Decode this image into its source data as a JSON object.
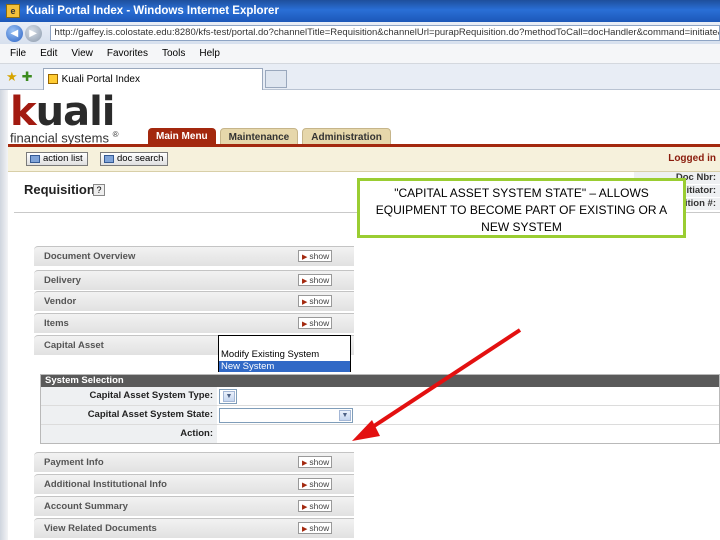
{
  "window": {
    "title": "Kuali Portal Index - Windows Internet Explorer"
  },
  "address": {
    "url": "http://gaffey.is.colostate.edu:8280/kfs-test/portal.do?channelTitle=Requisition&channelUrl=purapRequisition.do?methodToCall=docHandler&command=initiate&docTypeName="
  },
  "menu": {
    "items": [
      "File",
      "Edit",
      "View",
      "Favorites",
      "Tools",
      "Help"
    ]
  },
  "tab": {
    "label": "Kuali Portal Index"
  },
  "header": {
    "logo_word": "uali",
    "logo_k": "k",
    "logo_tagline": "financial systems",
    "logo_mark": "®",
    "nav": [
      "Main Menu",
      "Maintenance",
      "Administration"
    ]
  },
  "utility": {
    "action_list": "action list",
    "doc_search": "doc search",
    "logged_in": "Logged in"
  },
  "document": {
    "title": "Requisition",
    "help": "?",
    "doc_nbr": "Doc Nbr:",
    "initiator": "Initiator:",
    "requisition_num": "Requisition #:"
  },
  "sections": [
    {
      "label": "Document Overview",
      "toggle": "show"
    },
    {
      "label": "Delivery",
      "toggle": "show"
    },
    {
      "label": "Vendor",
      "toggle": "show"
    },
    {
      "label": "Items",
      "toggle": "show"
    },
    {
      "label": "Capital Asset",
      "toggle": "hide"
    },
    {
      "label": "Payment Info",
      "toggle": "show"
    },
    {
      "label": "Additional Institutional Info",
      "toggle": "show"
    },
    {
      "label": "Account Summary",
      "toggle": "show"
    },
    {
      "label": "View Related Documents",
      "toggle": "show"
    }
  ],
  "system_selection": {
    "heading": "System Selection",
    "type_label": "Capital Asset System Type:",
    "state_label": "Capital Asset System State:",
    "action_label": "Action:",
    "options": [
      "Modify Existing System",
      "New System"
    ]
  },
  "callout": {
    "text": "\"CAPITAL ASSET SYSTEM STATE\" – ALLOWS EQUIPMENT TO BECOME PART OF EXISTING OR A NEW SYSTEM"
  },
  "colors": {
    "kuali_red": "#a3280e",
    "callout_border": "#9acd32",
    "arrow": "#e31010",
    "selected_option": "#3169c6"
  }
}
